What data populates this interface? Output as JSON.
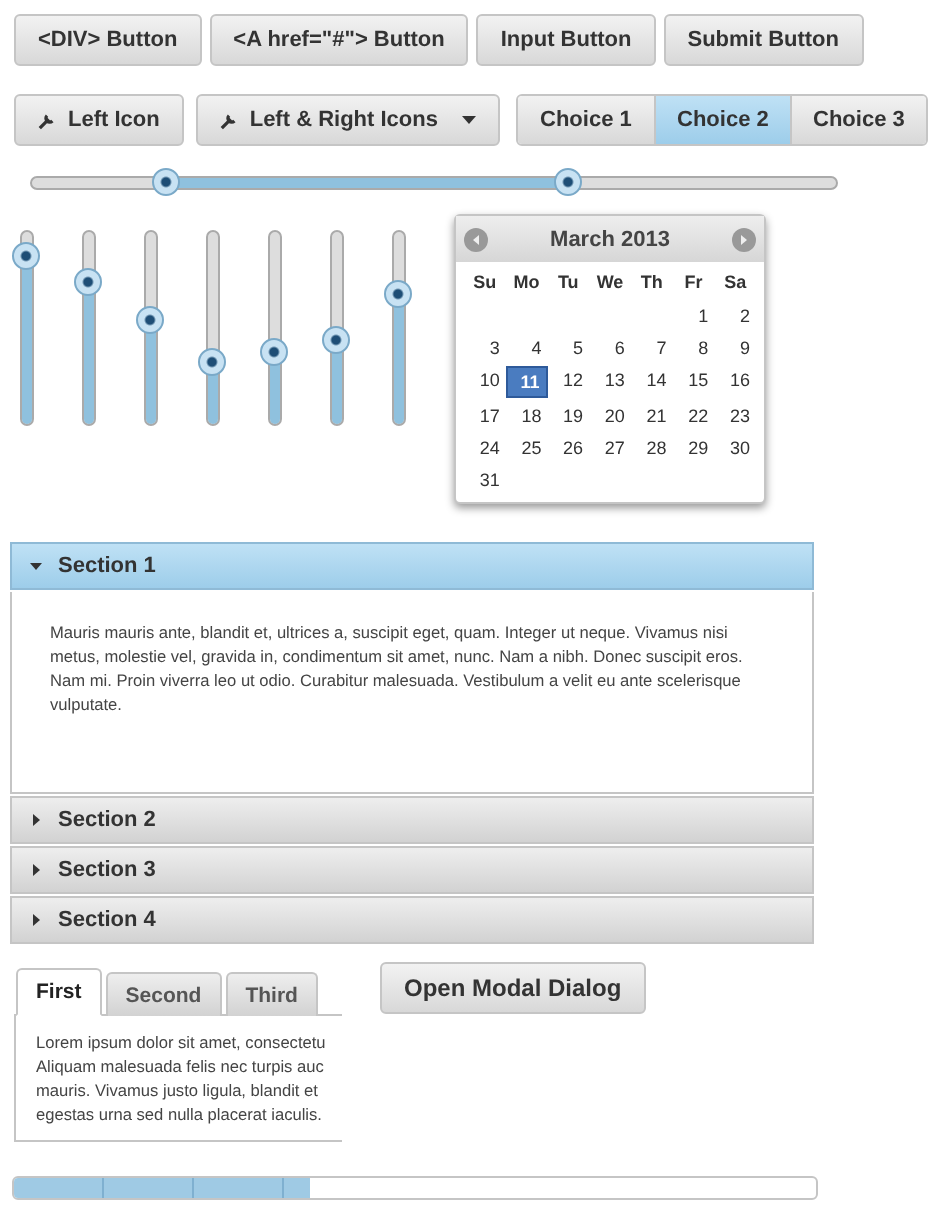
{
  "buttons": [
    "<DIV> Button",
    "<A href=\"#\"> Button",
    "Input Button",
    "Submit Button"
  ],
  "icon_buttons": [
    {
      "label": "Left Icon",
      "kind": "left"
    },
    {
      "label": "Left & Right Icons",
      "kind": "both"
    }
  ],
  "choices": [
    {
      "label": "Choice 1",
      "selected": false
    },
    {
      "label": "Choice 2",
      "selected": true
    },
    {
      "label": "Choice 3",
      "selected": false
    }
  ],
  "range_slider": {
    "low": {
      "level": 0.167
    },
    "high": {
      "level": 0.667
    }
  },
  "vertical_sliders": [
    {
      "level": 0.87
    },
    {
      "level": 0.74
    },
    {
      "level": 0.54
    },
    {
      "level": 0.32
    },
    {
      "level": 0.38
    },
    {
      "level": 0.44
    },
    {
      "level": 0.68
    }
  ],
  "calendar": {
    "title": "March 2013",
    "weekdays": [
      "Su",
      "Mo",
      "Tu",
      "We",
      "Th",
      "Fr",
      "Sa"
    ],
    "weeks": [
      [
        {
          "day": "1",
          "selected": false
        },
        {
          "day": "2",
          "selected": false
        }
      ],
      [
        {
          "day": "3",
          "selected": false
        },
        {
          "day": "4",
          "selected": false
        },
        {
          "day": "5",
          "selected": false
        },
        {
          "day": "6",
          "selected": false
        },
        {
          "day": "7",
          "selected": false
        },
        {
          "day": "8",
          "selected": false
        },
        {
          "day": "9",
          "selected": false
        }
      ],
      [
        {
          "day": "10",
          "selected": false
        },
        {
          "day": "11",
          "selected": true
        },
        {
          "day": "12",
          "selected": false
        },
        {
          "day": "13",
          "selected": false
        },
        {
          "day": "14",
          "selected": false
        },
        {
          "day": "15",
          "selected": false
        },
        {
          "day": "16",
          "selected": false
        }
      ],
      [
        {
          "day": "17",
          "selected": false
        },
        {
          "day": "18",
          "selected": false
        },
        {
          "day": "19",
          "selected": false
        },
        {
          "day": "20",
          "selected": false
        },
        {
          "day": "21",
          "selected": false
        },
        {
          "day": "22",
          "selected": false
        },
        {
          "day": "23",
          "selected": false
        }
      ],
      [
        {
          "day": "24",
          "selected": false
        },
        {
          "day": "25",
          "selected": false
        },
        {
          "day": "26",
          "selected": false
        },
        {
          "day": "27",
          "selected": false
        },
        {
          "day": "28",
          "selected": false
        },
        {
          "day": "29",
          "selected": false
        },
        {
          "day": "30",
          "selected": false
        }
      ],
      [
        {
          "day": "31",
          "selected": false
        }
      ]
    ]
  },
  "accordion": [
    {
      "title": "Section 1",
      "expanded": true,
      "body": "Mauris mauris ante, blandit et, ultrices a, suscipit eget, quam. Integer ut neque. Vivamus nisi metus, molestie vel, gravida in, condimentum sit amet, nunc. Nam a nibh. Donec suscipit eros. Nam mi. Proin viverra leo ut odio. Curabitur malesuada. Vestibulum a velit eu ante scelerisque vulputate."
    },
    {
      "title": "Section 2",
      "expanded": false
    },
    {
      "title": "Section 3",
      "expanded": false
    },
    {
      "title": "Section 4",
      "expanded": false
    }
  ],
  "tabs": [
    {
      "label": "First",
      "selected": true
    },
    {
      "label": "Second",
      "selected": false
    },
    {
      "label": "Third",
      "selected": false
    }
  ],
  "tab_body": "Lorem ipsum dolor sit amet, consectetu\nAliquam malesuada felis nec turpis auc\nmauris. Vivamus justo ligula, blandit et\negestas urna sed nulla placerat iaculis.",
  "modal_button": "Open Modal Dialog",
  "progress": {
    "level": 0.37
  }
}
